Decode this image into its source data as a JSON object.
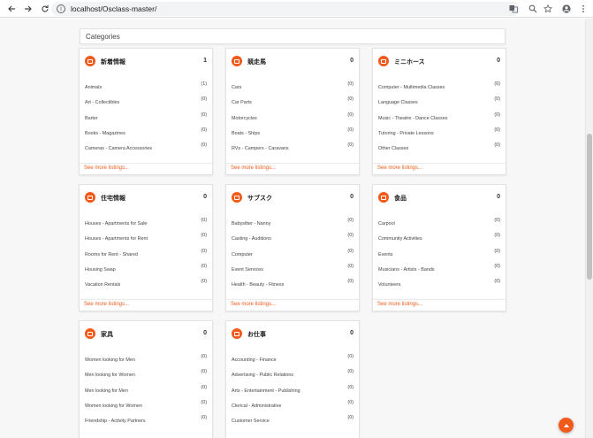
{
  "browser": {
    "url": "localhost/Osclass-master/"
  },
  "header": {
    "title": "Categories"
  },
  "cards": [
    {
      "title": "新着情報",
      "count": "1",
      "items": [
        {
          "name": "Animals",
          "count": "(1)"
        },
        {
          "name": "Art - Collectibles",
          "count": "(0)"
        },
        {
          "name": "Barter",
          "count": "(0)"
        },
        {
          "name": "Books - Magazines",
          "count": "(0)"
        },
        {
          "name": "Cameras - Camera Accessories",
          "count": "(0)"
        }
      ],
      "more": "See more listings..."
    },
    {
      "title": "競走馬",
      "count": "0",
      "items": [
        {
          "name": "Cars",
          "count": "(0)"
        },
        {
          "name": "Car Parts",
          "count": "(0)"
        },
        {
          "name": "Motorcycles",
          "count": "(0)"
        },
        {
          "name": "Boats - Ships",
          "count": "(0)"
        },
        {
          "name": "RVs - Campers - Caravans",
          "count": "(0)"
        }
      ],
      "more": "See more listings..."
    },
    {
      "title": "ミニホース",
      "count": "0",
      "items": [
        {
          "name": "Computer - Multimedia Classes",
          "count": "(0)"
        },
        {
          "name": "Language Classes",
          "count": "(0)"
        },
        {
          "name": "Music - Theatre - Dance Classes",
          "count": "(0)"
        },
        {
          "name": "Tutoring - Private Lessons",
          "count": "(0)"
        },
        {
          "name": "Other Classes",
          "count": "(0)"
        }
      ],
      "more": "See more listings..."
    },
    {
      "title": "住宅情報",
      "count": "0",
      "items": [
        {
          "name": "Houses - Apartments for Sale",
          "count": "(0)"
        },
        {
          "name": "Houses - Apartments for Rent",
          "count": "(0)"
        },
        {
          "name": "Rooms for Rent - Shared",
          "count": "(0)"
        },
        {
          "name": "Housing Swap",
          "count": "(0)"
        },
        {
          "name": "Vacation Rentals",
          "count": "(0)"
        }
      ],
      "more": "See more listings..."
    },
    {
      "title": "サブスク",
      "count": "0",
      "items": [
        {
          "name": "Babysitter - Nanny",
          "count": "(0)"
        },
        {
          "name": "Casting - Auditions",
          "count": "(0)"
        },
        {
          "name": "Computer",
          "count": "(0)"
        },
        {
          "name": "Event Services",
          "count": "(0)"
        },
        {
          "name": "Health - Beauty - Fitness",
          "count": "(0)"
        }
      ],
      "more": "See more listings..."
    },
    {
      "title": "食品",
      "count": "0",
      "items": [
        {
          "name": "Carpool",
          "count": "(0)"
        },
        {
          "name": "Community Activities",
          "count": "(0)"
        },
        {
          "name": "Events",
          "count": "(0)"
        },
        {
          "name": "Musicians - Artists - Bands",
          "count": "(0)"
        },
        {
          "name": "Volunteers",
          "count": "(0)"
        }
      ],
      "more": "See more listings..."
    },
    {
      "title": "家具",
      "count": "0",
      "items": [
        {
          "name": "Women looking for Men",
          "count": "(0)"
        },
        {
          "name": "Men looking for Women",
          "count": "(0)"
        },
        {
          "name": "Men looking for Men",
          "count": "(0)"
        },
        {
          "name": "Women looking for Women",
          "count": "(0)"
        },
        {
          "name": "Friendship - Activity Partners",
          "count": "(0)"
        }
      ],
      "more": ""
    },
    {
      "title": "お仕事",
      "count": "0",
      "items": [
        {
          "name": "Accounting - Finance",
          "count": "(0)"
        },
        {
          "name": "Advertising - Public Relations",
          "count": "(0)"
        },
        {
          "name": "Arts - Entertainment - Publishing",
          "count": "(0)"
        },
        {
          "name": "Clerical - Administrative",
          "count": "(0)"
        },
        {
          "name": "Customer Service",
          "count": "(0)"
        }
      ],
      "more": ""
    }
  ],
  "colors": {
    "accent": "#f15a1a"
  },
  "icons": [
    "back-arrow-icon",
    "forward-arrow-icon",
    "reload-icon",
    "info-icon",
    "translate-icon",
    "zoom-icon",
    "star-icon",
    "account-icon",
    "menu-dots-icon",
    "category-icon",
    "scroll-top-icon"
  ]
}
